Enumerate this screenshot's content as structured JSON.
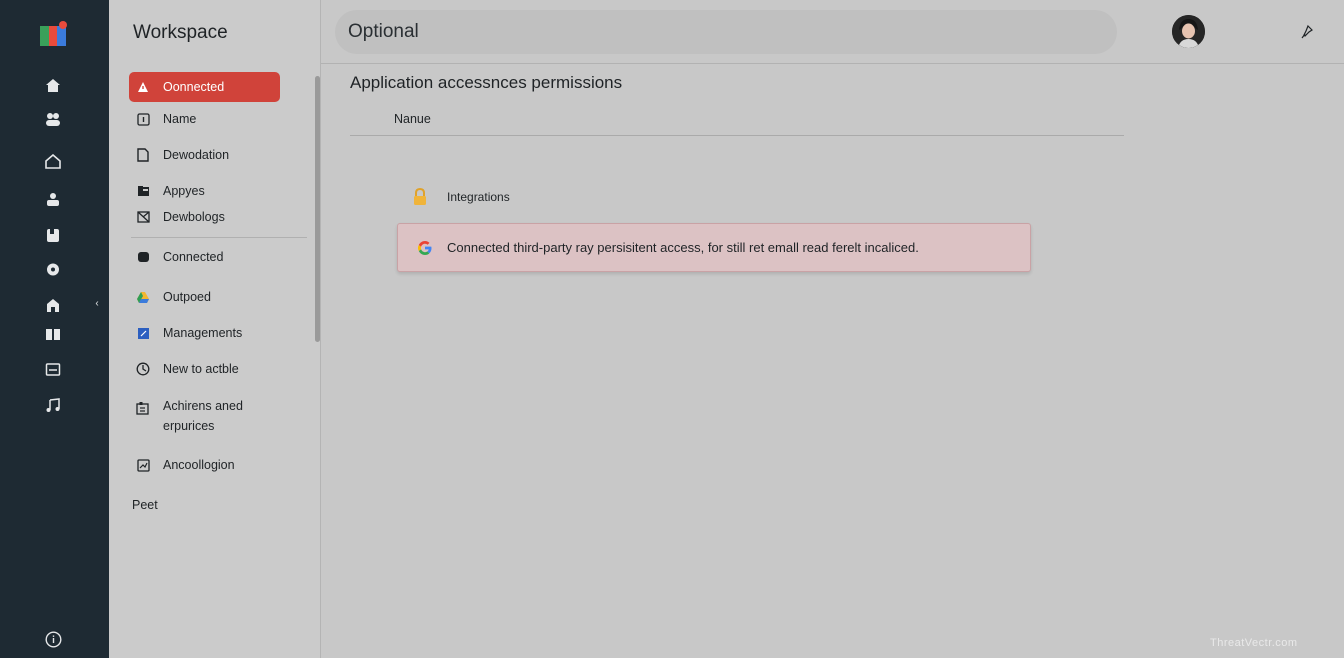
{
  "rail": {
    "icons": [
      "home-icon",
      "people-icon",
      "house-icon",
      "user-group-icon",
      "bookmark-icon",
      "gear-icon",
      "building-icon",
      "tiles-icon",
      "inbox-icon",
      "music-icon"
    ],
    "collapse_glyph": "‹",
    "info_icon": "info-icon"
  },
  "sidebar": {
    "title": "Workspace",
    "items": [
      {
        "label": "Oonnected",
        "icon": "alert-icon",
        "active": true
      },
      {
        "label": "Name",
        "icon": "info-box-icon"
      },
      {
        "label": "Dewodation",
        "icon": "document-icon"
      },
      {
        "label": "Appyes",
        "icon": "folder-icon"
      },
      {
        "label": "Dewbologs",
        "icon": "image-box-icon"
      },
      {
        "label": "Connected",
        "icon": "chat-icon"
      },
      {
        "label": "Outpoed",
        "icon": "drive-icon"
      },
      {
        "label": "Managements",
        "icon": "blue-square-icon"
      },
      {
        "label": "New to actble",
        "icon": "clock-icon"
      },
      {
        "label": "Achirens aned erpurices",
        "icon": "grid-icon"
      },
      {
        "label": "Ancoollogion",
        "icon": "chart-box-icon"
      }
    ],
    "footer": "Peet"
  },
  "topbar": {
    "search_text": "Optional"
  },
  "main": {
    "title": "Application accessnces permissions",
    "column_header": "Nanue",
    "integration_label": "Integrations",
    "alert_text": "Connected third-party ray persisitent access, for still ret emall read ferelt incaliced."
  },
  "watermark": "ThreatVectr.com",
  "colors": {
    "rail": "#1e2a33",
    "sidebar": "#cbcbcb",
    "active": "#d0433a",
    "alert_bg": "#dcc2c4",
    "content_bg": "#c8c8c8"
  }
}
